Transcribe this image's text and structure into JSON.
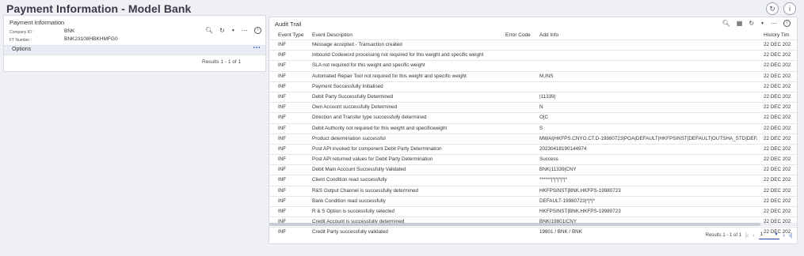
{
  "header": {
    "title": "Payment Information - Model Bank",
    "icons": [
      "refresh-icon",
      "info-icon"
    ]
  },
  "left_panel": {
    "title": "Payment Information",
    "fields": [
      {
        "label": "Company ID :",
        "value": "BNK"
      },
      {
        "label": "FT Number :",
        "value": "BNK23108HBKHMFG0"
      }
    ],
    "options_label": "Options",
    "results": "Results 1 - 1 of 1"
  },
  "audit_trail": {
    "title": "Audit Trail",
    "columns": [
      "Event Type",
      "Event Description",
      "Error Code",
      "Add Info",
      "History Tim"
    ],
    "rows": [
      {
        "type": "INF",
        "desc": "Message accepted - Transaction created",
        "err": "",
        "info": "",
        "time": "22 DEC 202"
      },
      {
        "type": "INF",
        "desc": "Inbound Codeword processing not required for this weight and specific weight",
        "err": "",
        "info": "",
        "time": "22 DEC 202"
      },
      {
        "type": "INF",
        "desc": "SLA not required for this weight and specific weight",
        "err": "",
        "info": "",
        "time": "22 DEC 202"
      },
      {
        "type": "INF",
        "desc": "Automated Repair Tool not required for this weight and specific weight",
        "err": "",
        "info": "M,INS",
        "time": "22 DEC 202"
      },
      {
        "type": "INF",
        "desc": "Payment Successfully Initialised",
        "err": "",
        "info": "",
        "time": "22 DEC 202"
      },
      {
        "type": "INF",
        "desc": "Debit Party Successfully Determined",
        "err": "",
        "info": "|11339|",
        "time": "22 DEC 202"
      },
      {
        "type": "INF",
        "desc": "Own Account successfully Determined",
        "err": "",
        "info": "N",
        "time": "22 DEC 202"
      },
      {
        "type": "INF",
        "desc": "Direction and Transfer type successfully determined",
        "err": "",
        "info": "O|C",
        "time": "22 DEC 202"
      },
      {
        "type": "INF",
        "desc": "Debit Authority not required for this weight and specificweight",
        "err": "",
        "info": "S",
        "time": "22 DEC 202"
      },
      {
        "type": "INF",
        "desc": "Product determination successful",
        "err": "",
        "info": "MWAI|HKFPS.CNYO.CT.D-19980723|POA|DEFAULT|HKFPSINST|DEFAULT|OUTSHA_STD|DEFAULT",
        "time": "22 DEC 202"
      },
      {
        "type": "INF",
        "desc": "Post API invoked for component Debit Party Determination",
        "err": "",
        "info": "20230418190144974",
        "time": "22 DEC 202"
      },
      {
        "type": "INF",
        "desc": "Post API returned values for Debit Party Determination",
        "err": "",
        "info": "Success",
        "time": "22 DEC 202"
      },
      {
        "type": "INF",
        "desc": "Debit Main Account Successfully Validated",
        "err": "",
        "info": "BNK|11339|CNY",
        "time": "22 DEC 202"
      },
      {
        "type": "INF",
        "desc": "Client Condition read successfully",
        "err": "",
        "info": "******|*|*|*|*|*",
        "time": "22 DEC 202"
      },
      {
        "type": "INF",
        "desc": "R&S Output Channel is successfully determined",
        "err": "",
        "info": "HKFPSINST|BNK.HKFPS-19980723",
        "time": "22 DEC 202"
      },
      {
        "type": "INF",
        "desc": "Bank Condition read successfully",
        "err": "",
        "info": "DEFAULT-19980723|*|*|*",
        "time": "22 DEC 202"
      },
      {
        "type": "INF",
        "desc": "R & S Option is successfully selected",
        "err": "",
        "info": "HKFPSINST|BNK.HKFPS-19980723",
        "time": "22 DEC 202"
      },
      {
        "type": "INF",
        "desc": "Credit Account is successfully determined",
        "err": "",
        "info": "BNK|19801|CNY",
        "time": "22 DEC 202"
      },
      {
        "type": "INF",
        "desc": "Credit Party successfully validated",
        "err": "",
        "info": "19801 / BNK / BNK",
        "time": "22 DEC 202"
      }
    ],
    "results": "Results 1 - 1 of 1",
    "page": "1"
  }
}
